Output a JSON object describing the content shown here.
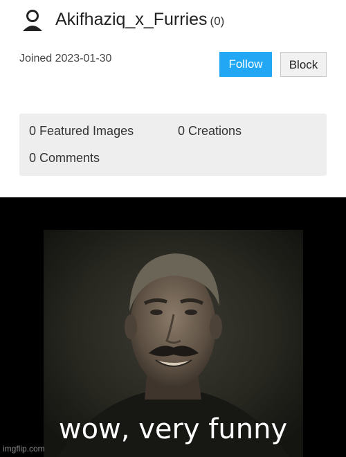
{
  "profile": {
    "username": "Akifhaziq_x_Furries",
    "count": "(0)",
    "joined": "Joined 2023-01-30",
    "follow_label": "Follow",
    "block_label": "Block",
    "user_icon": "user-icon"
  },
  "stats": {
    "featured": "0 Featured Images",
    "creations": "0 Creations",
    "comments": "0 Comments"
  },
  "meme": {
    "caption": "wow, very funny",
    "watermark": "imgflip.com"
  },
  "colors": {
    "follow_bg": "#22a7f5",
    "stats_bg": "#eeeeee",
    "meme_bg": "#000000"
  }
}
